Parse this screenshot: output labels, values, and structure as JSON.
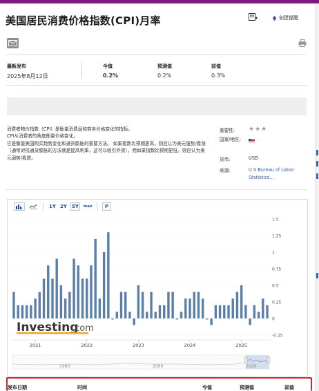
{
  "page_title": "美国居民消费价格指数(CPI)月率",
  "header": {
    "alert_button_label": "创建提醒"
  },
  "stats": {
    "latest_label": "最新发布",
    "latest_date": "2025年8月12日",
    "actual_label": "今值",
    "actual_value": "0.2%",
    "forecast_label": "预测值",
    "forecast_value": "0.2%",
    "previous_label": "前值",
    "previous_value": "0.3%"
  },
  "description": {
    "p1": "消费者物价指数（CPI）是衡量消费品和劳务价格变化的指标。",
    "p2": "CPI从消费者的角度衡量价格变化。",
    "p3": "它是衡量美国购买趋势变化和通货膨胀的重要方法。 如果指数比预期更高，则应认为美元强势/看涨（通常对抗通货膨胀的方法就是提高利率，这可以吸引外资），而如果指数比预期更低，则应认为美元弱势/看跌。"
  },
  "meta": {
    "importance_label": "重要性:",
    "importance_stars": "★★★",
    "country_label": "国家/地区:",
    "currency_label": "货币:",
    "currency_value": "USD",
    "source_label": "来源:",
    "source_value_line1": "U.S Bureau of Labor",
    "source_value_line2": "Statistics..."
  },
  "chart_toolbar": {
    "range_1y": "1Y",
    "range_2y": "2Y",
    "range_5y": "5Y",
    "range_max": "max",
    "print_label": "P"
  },
  "watermark": {
    "brand": "Investing",
    "suffix": ".com"
  },
  "navigator_labels": [
    "1980",
    "2000",
    "2020"
  ],
  "table_header": {
    "col_date": "发布日期",
    "col_time": "时间",
    "col_actual": "今值",
    "col_forecast": "预测值",
    "col_previous": "前值"
  },
  "colors": {
    "bar": "#5b7fa8",
    "brand_bar": "#7a1a7a",
    "highlight": "#d8252a",
    "link": "#2a5db0"
  },
  "chart_data": {
    "type": "bar",
    "x_tick_labels": [
      "2021",
      "2022",
      "2023",
      "2024",
      "2025"
    ],
    "y_tick_labels": [
      "1.5",
      "1.25",
      "1",
      "0.75",
      "0.5",
      "0.25",
      "0",
      "-0.25"
    ],
    "ylim": [
      -0.25,
      1.5
    ],
    "months": [
      "2020-08",
      "2020-09",
      "2020-10",
      "2020-11",
      "2020-12",
      "2021-01",
      "2021-02",
      "2021-03",
      "2021-04",
      "2021-05",
      "2021-06",
      "2021-07",
      "2021-08",
      "2021-09",
      "2021-10",
      "2021-11",
      "2021-12",
      "2022-01",
      "2022-02",
      "2022-03",
      "2022-04",
      "2022-05",
      "2022-06",
      "2022-07",
      "2022-08",
      "2022-09",
      "2022-10",
      "2022-11",
      "2022-12",
      "2023-01",
      "2023-02",
      "2023-03",
      "2023-04",
      "2023-05",
      "2023-06",
      "2023-07",
      "2023-08",
      "2023-09",
      "2023-10",
      "2023-11",
      "2023-12",
      "2024-01",
      "2024-02",
      "2024-03",
      "2024-04",
      "2024-05",
      "2024-06",
      "2024-07",
      "2024-08",
      "2024-09",
      "2024-10",
      "2024-11",
      "2024-12",
      "2025-01",
      "2025-02",
      "2025-03",
      "2025-04",
      "2025-05",
      "2025-06",
      "2025-07"
    ],
    "values": [
      0.4,
      0.2,
      0.2,
      0.2,
      0.2,
      0.3,
      0.4,
      0.6,
      0.8,
      0.6,
      0.9,
      0.5,
      0.3,
      0.4,
      0.9,
      0.8,
      0.6,
      0.6,
      0.8,
      1.2,
      0.3,
      1.0,
      1.3,
      0.0,
      0.1,
      0.4,
      0.4,
      0.1,
      -0.1,
      0.5,
      0.4,
      0.1,
      0.4,
      0.1,
      0.2,
      0.2,
      0.4,
      0.4,
      0.0,
      0.1,
      0.3,
      0.3,
      0.4,
      0.4,
      0.3,
      0.0,
      -0.1,
      0.2,
      0.2,
      0.2,
      0.2,
      0.3,
      0.4,
      0.5,
      0.2,
      -0.1,
      0.2,
      0.1,
      0.3,
      0.2
    ]
  }
}
